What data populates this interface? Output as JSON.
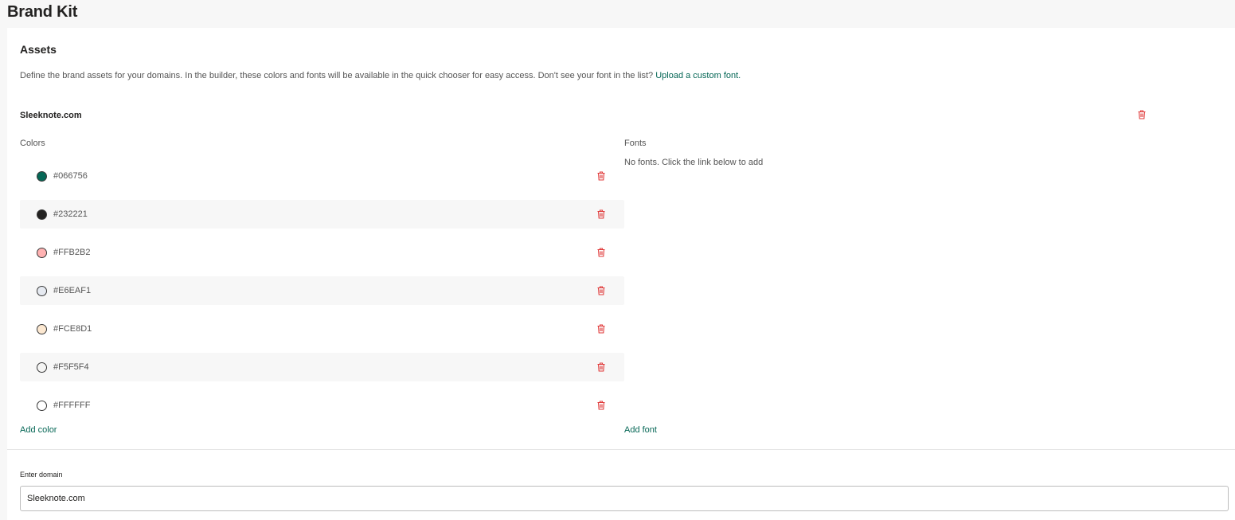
{
  "page": {
    "title": "Brand Kit"
  },
  "assets": {
    "title": "Assets",
    "description": "Define the brand assets for your domains. In the builder, these colors and fonts will be available in the quick chooser for easy access. Don't see your font in the list? ",
    "upload_link": "Upload a custom font."
  },
  "domain": {
    "name": "Sleeknote.com",
    "delete_icon": "trash-icon",
    "colors_label": "Colors",
    "fonts_label": "Fonts",
    "no_fonts": "No fonts. Click the link below to add",
    "colors": [
      {
        "hex": "#066756"
      },
      {
        "hex": "#232221"
      },
      {
        "hex": "#FFB2B2"
      },
      {
        "hex": "#E6EAF1"
      },
      {
        "hex": "#FCE8D1"
      },
      {
        "hex": "#F5F5F4"
      },
      {
        "hex": "#FFFFFF"
      }
    ],
    "add_color": "Add color",
    "add_font": "Add font"
  },
  "domain_input": {
    "label": "Enter domain",
    "value": "Sleeknote.com"
  },
  "theme": {
    "accent": "#066756",
    "danger": "#e03a3a"
  }
}
